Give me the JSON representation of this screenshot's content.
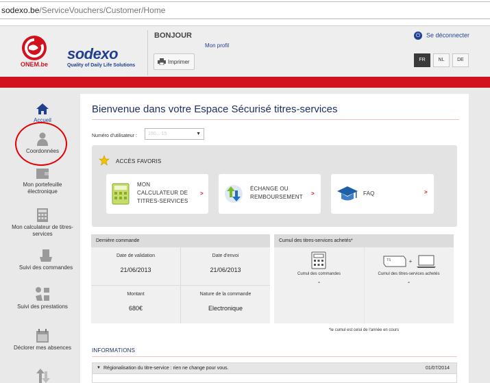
{
  "browser": {
    "url_host": "sodexo.be",
    "url_path": "/ServiceVouchers/Customer/Home"
  },
  "header": {
    "logo_onem": "ONEM.be",
    "logo_sodexo": "sodexo",
    "logo_tagline": "Quality of Daily Life Solutions",
    "greeting": "BONJOUR",
    "profile_link": "Mon profil",
    "print_label": "Imprimer",
    "logout_label": "Se déconnecter",
    "languages": [
      "FR",
      "NL",
      "DE"
    ],
    "active_language": "FR"
  },
  "colors": {
    "brand_red": "#d1111d",
    "brand_blue": "#1f3f91",
    "highlight_circle": "#e30000"
  },
  "sidebar": {
    "items": [
      {
        "label": "Accueil",
        "icon": "home-icon"
      },
      {
        "label": "Coordonnées",
        "icon": "user-icon"
      },
      {
        "label": "Mon portefeuille électronique",
        "icon": "wallet-icon"
      },
      {
        "label": "Mon calculateur de titres-services",
        "icon": "calculator-icon"
      },
      {
        "label": "Suivi des commandes",
        "icon": "orders-icon"
      },
      {
        "label": "Suivi des prestations",
        "icon": "services-icon"
      },
      {
        "label": "Déclorer mes absences",
        "icon": "calendar-icon"
      }
    ]
  },
  "main": {
    "welcome": "Bienvenue dans votre Espace Sécurisé titres-services",
    "user_number_label": "Numéro d'utilisateur :",
    "user_number_value": "190...          15",
    "favorites": {
      "title": "ACCÈS FAVORIS",
      "cards": [
        {
          "line1": "MON",
          "line2": "CALCULATEUR DE",
          "line3": "TITRES-SERVICES",
          "icon": "calculator-icon"
        },
        {
          "line1": "ÉCHANGE OU",
          "line2": "REMBOURSEMENT",
          "line3": "",
          "icon": "exchange-icon"
        },
        {
          "line1": "FAQ",
          "line2": "",
          "line3": "",
          "icon": "graduation-cap-icon"
        }
      ],
      "chevron": ">"
    },
    "last_order": {
      "title": "Dernière commande",
      "validation_label": "Date de validation",
      "validation_value": "21/06/2013",
      "send_label": "Date d'envoi",
      "send_value": "21/06/2013",
      "amount_label": "Montant",
      "amount_value": "680€",
      "nature_label": "Nature de la commande",
      "nature_value": "Electronique"
    },
    "cumulative": {
      "title": "Cumul des titres-services achetés*",
      "orders_label": "Cumul des commandes",
      "orders_value": "-",
      "purchased_label": "Cumul des titres-services achetés",
      "purchased_value": "-",
      "plus": "+",
      "voucher_tag": "TS",
      "note": "*le cumul est celui de l'année en cours"
    },
    "info": {
      "title": "INFORMATIONS",
      "news": [
        {
          "title": "Régionalisation du titre-service : rien ne change pour vous.",
          "date": "01/07/2014"
        }
      ]
    }
  }
}
